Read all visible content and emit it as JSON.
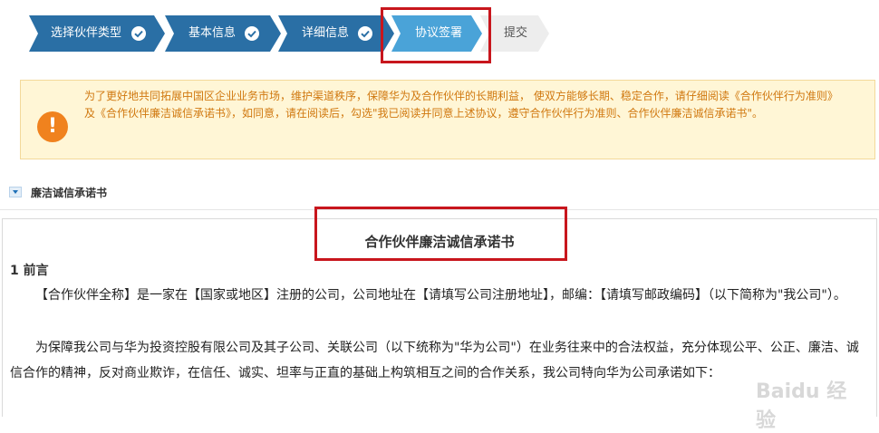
{
  "stepper": {
    "steps": [
      {
        "label": "选择伙伴类型",
        "state": "done"
      },
      {
        "label": "基本信息",
        "state": "done"
      },
      {
        "label": "详细信息",
        "state": "done"
      },
      {
        "label": "协议签署",
        "state": "active"
      },
      {
        "label": "提交",
        "state": "pending"
      }
    ]
  },
  "notice": {
    "text": "为了更好地共同拓展中国区企业业务市场，维护渠道秩序，保障华为及合作伙伴的长期利益， 使双方能够长期、稳定合作，请仔细阅读《合作伙伴行为准则》及《合作伙伴廉洁诚信承诺书》，如同意，请在阅读后，勾选\"我已阅读并同意上述协议，遵守合作伙伴行为准则、合作伙伴廉洁诚信承诺书\"。"
  },
  "section": {
    "title": "廉洁诚信承诺书"
  },
  "document": {
    "title": "合作伙伴廉洁诚信承诺书",
    "section1": "1 前言",
    "para1": "【合作伙伴全称】是一家在【国家或地区】注册的公司，公司地址在【请填写公司注册地址】，邮编：【请填写邮政编码】（以下简称为\"我公司\"）。",
    "para2": "为保障我公司与华为投资控股有限公司及其子公司、关联公司（以下统称为\"华为公司\"）在业务往来中的合法权益，充分体现公平、公正、廉洁、诚信合作的精神，反对商业欺诈，在信任、诚实、坦率与正直的基础上构筑相互之间的合作关系，我公司特向华为公司承诺如下："
  },
  "watermark": "Baidu 经验",
  "colors": {
    "step_done": "#2a6fa5",
    "step_active": "#4aa3d8",
    "step_pending": "#ededed",
    "highlight": "#c8161d",
    "notice_bg": "#fff6d6",
    "notice_icon": "#f0821e"
  }
}
